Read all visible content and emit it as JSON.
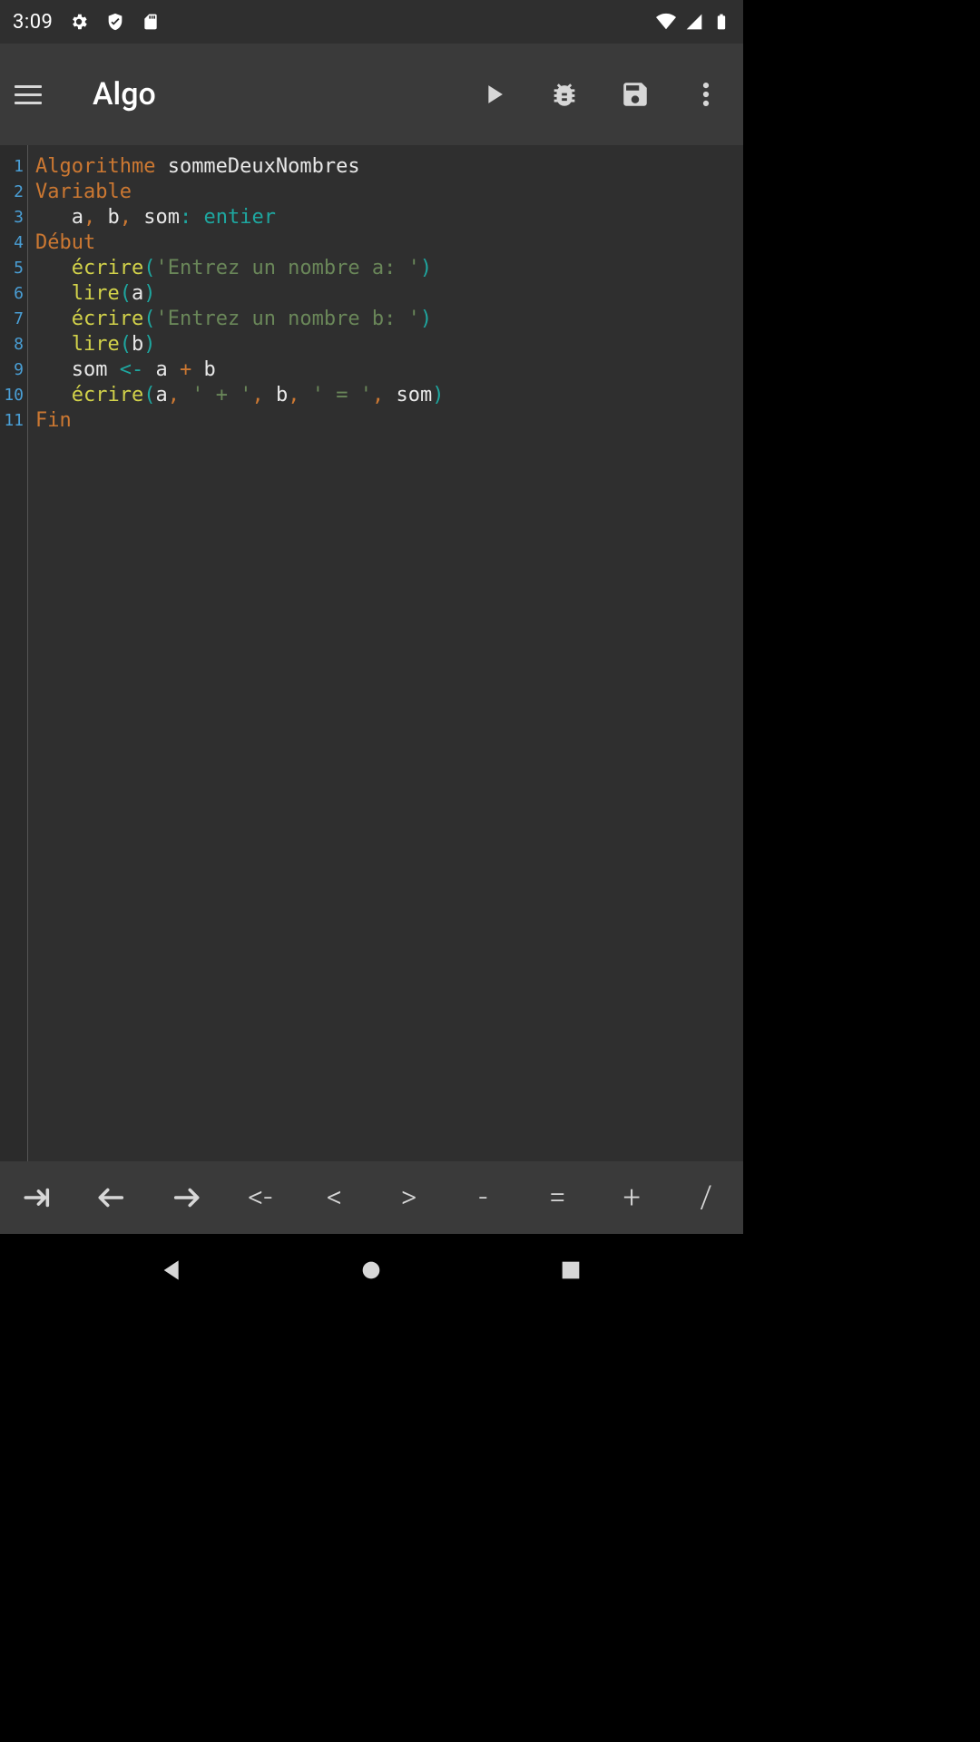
{
  "status": {
    "time": "3:09",
    "icons_left": [
      "gear-icon",
      "shield-icon",
      "sd-card-icon"
    ],
    "icons_right": [
      "wifi-icon",
      "signal-icon",
      "battery-icon"
    ]
  },
  "appbar": {
    "title": "Algo",
    "actions": [
      "run",
      "debug",
      "save",
      "more"
    ]
  },
  "editor": {
    "lines": [
      {
        "n": "1",
        "tokens": [
          [
            "kw-algo",
            "Algorithme"
          ],
          [
            "ident",
            " sommeDeuxNombres"
          ]
        ]
      },
      {
        "n": "2",
        "tokens": [
          [
            "kw-var",
            "Variable"
          ]
        ]
      },
      {
        "n": "3",
        "tokens": [
          [
            "ident",
            "   a"
          ],
          [
            "comma",
            ","
          ],
          [
            "ident",
            " b"
          ],
          [
            "comma",
            ","
          ],
          [
            "ident",
            " som"
          ],
          [
            "op",
            ":"
          ],
          [
            "type",
            " entier"
          ]
        ]
      },
      {
        "n": "4",
        "tokens": [
          [
            "kw-deb",
            "Début"
          ]
        ]
      },
      {
        "n": "5",
        "tokens": [
          [
            "ident",
            "   "
          ],
          [
            "fn",
            "écrire"
          ],
          [
            "punct",
            "("
          ],
          [
            "str",
            "'Entrez un nombre a: '"
          ],
          [
            "punct",
            ")"
          ]
        ]
      },
      {
        "n": "6",
        "tokens": [
          [
            "ident",
            "   "
          ],
          [
            "fn",
            "lire"
          ],
          [
            "punct",
            "("
          ],
          [
            "ident",
            "a"
          ],
          [
            "punct",
            ")"
          ]
        ]
      },
      {
        "n": "7",
        "tokens": [
          [
            "ident",
            "   "
          ],
          [
            "fn",
            "écrire"
          ],
          [
            "punct",
            "("
          ],
          [
            "str",
            "'Entrez un nombre b: '"
          ],
          [
            "punct",
            ")"
          ]
        ]
      },
      {
        "n": "8",
        "tokens": [
          [
            "ident",
            "   "
          ],
          [
            "fn",
            "lire"
          ],
          [
            "punct",
            "("
          ],
          [
            "ident",
            "b"
          ],
          [
            "punct",
            ")"
          ]
        ]
      },
      {
        "n": "9",
        "tokens": [
          [
            "ident",
            "   som "
          ],
          [
            "op",
            "<-"
          ],
          [
            "ident",
            " a "
          ],
          [
            "plus",
            "+"
          ],
          [
            "ident",
            " b"
          ]
        ]
      },
      {
        "n": "10",
        "tokens": [
          [
            "ident",
            "   "
          ],
          [
            "fn",
            "écrire"
          ],
          [
            "punct",
            "("
          ],
          [
            "ident",
            "a"
          ],
          [
            "comma",
            ","
          ],
          [
            "str",
            " ' + '"
          ],
          [
            "comma",
            ","
          ],
          [
            "ident",
            " b"
          ],
          [
            "comma",
            ","
          ],
          [
            "str",
            " ' = '"
          ],
          [
            "comma",
            ","
          ],
          [
            "ident",
            " som"
          ],
          [
            "punct",
            ")"
          ]
        ]
      },
      {
        "n": "11",
        "tokens": [
          [
            "kw-fin",
            "Fin"
          ]
        ]
      }
    ]
  },
  "symbolbar": {
    "keys": [
      "tab-right",
      "arrow-left",
      "arrow-right",
      "<-",
      "<",
      ">",
      "-",
      "=",
      "+",
      "/"
    ]
  },
  "navbar": {
    "buttons": [
      "back",
      "home",
      "recent"
    ]
  }
}
